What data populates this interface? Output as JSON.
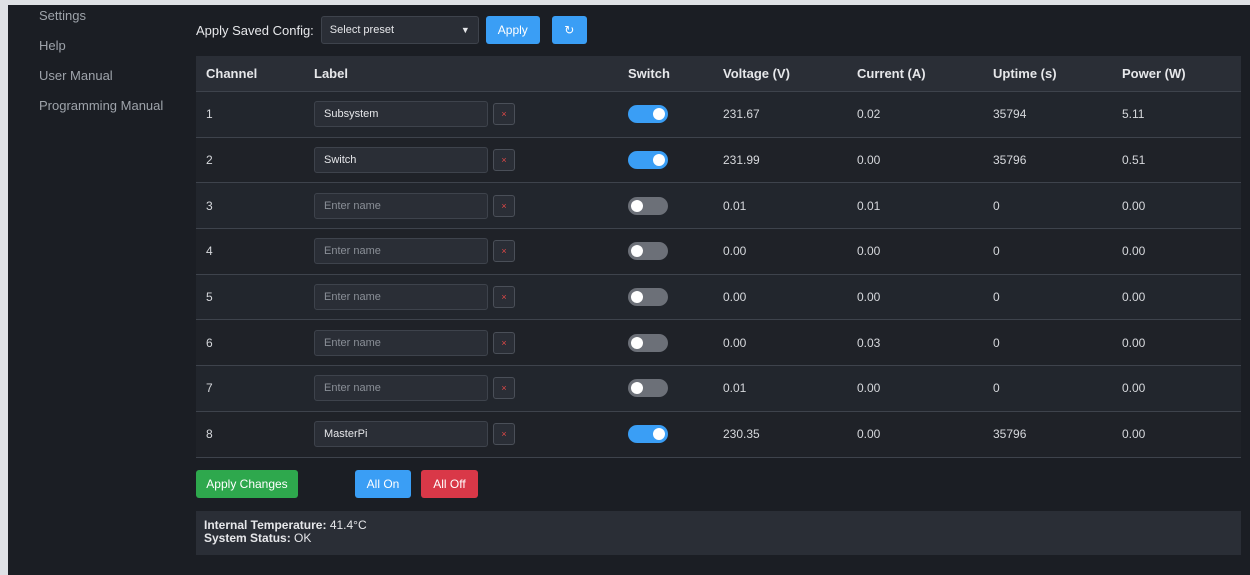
{
  "sidebar": {
    "items": [
      {
        "label": "Settings"
      },
      {
        "label": "Help"
      },
      {
        "label": "User Manual"
      },
      {
        "label": "Programming Manual"
      }
    ]
  },
  "config": {
    "label": "Apply Saved Config:",
    "select_value": "Select preset",
    "apply_label": "Apply",
    "refresh_icon": "↻"
  },
  "table": {
    "headers": [
      "Channel",
      "Label",
      "Switch",
      "Voltage (V)",
      "Current (A)",
      "Uptime (s)",
      "Power (W)"
    ],
    "placeholder": "Enter name",
    "clear_glyph": "×",
    "rows": [
      {
        "channel": "1",
        "label": "Subsystem",
        "switch_on": true,
        "voltage": "231.67",
        "current": "0.02",
        "uptime": "35794",
        "power": "5.11"
      },
      {
        "channel": "2",
        "label": "Switch",
        "switch_on": true,
        "voltage": "231.99",
        "current": "0.00",
        "uptime": "35796",
        "power": "0.51"
      },
      {
        "channel": "3",
        "label": "",
        "switch_on": false,
        "voltage": "0.01",
        "current": "0.01",
        "uptime": "0",
        "power": "0.00"
      },
      {
        "channel": "4",
        "label": "",
        "switch_on": false,
        "voltage": "0.00",
        "current": "0.00",
        "uptime": "0",
        "power": "0.00"
      },
      {
        "channel": "5",
        "label": "",
        "switch_on": false,
        "voltage": "0.00",
        "current": "0.00",
        "uptime": "0",
        "power": "0.00"
      },
      {
        "channel": "6",
        "label": "",
        "switch_on": false,
        "voltage": "0.00",
        "current": "0.03",
        "uptime": "0",
        "power": "0.00"
      },
      {
        "channel": "7",
        "label": "",
        "switch_on": false,
        "voltage": "0.01",
        "current": "0.00",
        "uptime": "0",
        "power": "0.00"
      },
      {
        "channel": "8",
        "label": "MasterPi",
        "switch_on": true,
        "voltage": "230.35",
        "current": "0.00",
        "uptime": "35796",
        "power": "0.00"
      }
    ]
  },
  "actions": {
    "apply_changes": "Apply Changes",
    "all_on": "All On",
    "all_off": "All Off"
  },
  "status": {
    "temp_label": "Internal Temperature:",
    "temp_value": "41.4°C",
    "system_label": "System Status:",
    "system_value": "OK"
  },
  "colors": {
    "accent": "#3a9ef5",
    "success": "#2ea84d",
    "danger": "#d93848"
  }
}
